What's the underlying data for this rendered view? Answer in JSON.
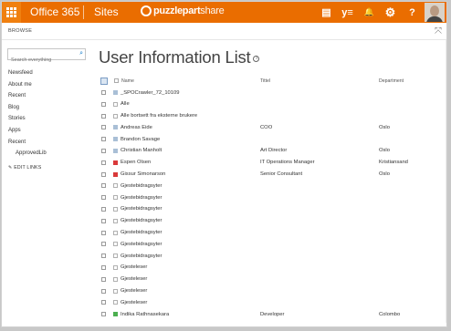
{
  "suitebar": {
    "product": "Office 365",
    "sites": "Sites",
    "logo_bold": "puzzlepart",
    "logo_light": "share",
    "icons": [
      "outlook-icon",
      "yammer-icon",
      "bell-icon",
      "gear-icon",
      "help-icon"
    ],
    "icon_glyphs": [
      "▤",
      "y≡",
      "🔔",
      "⚙",
      "?"
    ],
    "color": "#ea6d00"
  },
  "ribbon": {
    "browse": "BROWSE",
    "focus_glyph": "⤧"
  },
  "left_nav": {
    "search_placeholder": "Search everything",
    "items": [
      "Newsfeed",
      "About me",
      "Recent",
      "Blog",
      "Stories",
      "Apps",
      "Recent",
      "ApprovedLib"
    ],
    "edit_links": "EDIT LINKS"
  },
  "page": {
    "title": "User Information List",
    "info_glyph": "i"
  },
  "list": {
    "columns": {
      "name": "Name",
      "title": "Tittel",
      "department": "Department"
    },
    "rows": [
      {
        "name": "_SPOCrawler_72_10109",
        "title": "",
        "department": "",
        "pic": "#a9bfd6"
      },
      {
        "name": "Alle",
        "title": "",
        "department": "",
        "pic": ""
      },
      {
        "name": "Alle bortsett fra eksterne brukere",
        "title": "",
        "department": "",
        "pic": ""
      },
      {
        "name": "Andreas Eide",
        "title": "COO",
        "department": "Oslo",
        "pic": "#a9bfd6"
      },
      {
        "name": "Brandon Savage",
        "title": "",
        "department": "",
        "pic": "#a9bfd6"
      },
      {
        "name": "Christian Manholt",
        "title": "Art Director",
        "department": "Oslo",
        "pic": "#a9bfd6"
      },
      {
        "name": "Espen Olsen",
        "title": "IT Operations Manager",
        "department": "Kristiansand",
        "pic": "#d9393a"
      },
      {
        "name": "Gissur Simonarson",
        "title": "Senior Consultant",
        "department": "Oslo",
        "pic": "#d9393a"
      },
      {
        "name": "Gjestebidragsyter",
        "title": "",
        "department": "",
        "pic": ""
      },
      {
        "name": "Gjestebidragsyter",
        "title": "",
        "department": "",
        "pic": ""
      },
      {
        "name": "Gjestebidragsyter",
        "title": "",
        "department": "",
        "pic": ""
      },
      {
        "name": "Gjestebidragsyter",
        "title": "",
        "department": "",
        "pic": ""
      },
      {
        "name": "Gjestebidragsyter",
        "title": "",
        "department": "",
        "pic": ""
      },
      {
        "name": "Gjestebidragsyter",
        "title": "",
        "department": "",
        "pic": ""
      },
      {
        "name": "Gjestebidragsyter",
        "title": "",
        "department": "",
        "pic": ""
      },
      {
        "name": "Gjesteleser",
        "title": "",
        "department": "",
        "pic": ""
      },
      {
        "name": "Gjesteleser",
        "title": "",
        "department": "",
        "pic": ""
      },
      {
        "name": "Gjesteleser",
        "title": "",
        "department": "",
        "pic": ""
      },
      {
        "name": "Gjesteleser",
        "title": "",
        "department": "",
        "pic": ""
      },
      {
        "name": "Indika Rathnasekara",
        "title": "Developer",
        "department": "Colombo",
        "pic": "#4caf50"
      }
    ]
  }
}
